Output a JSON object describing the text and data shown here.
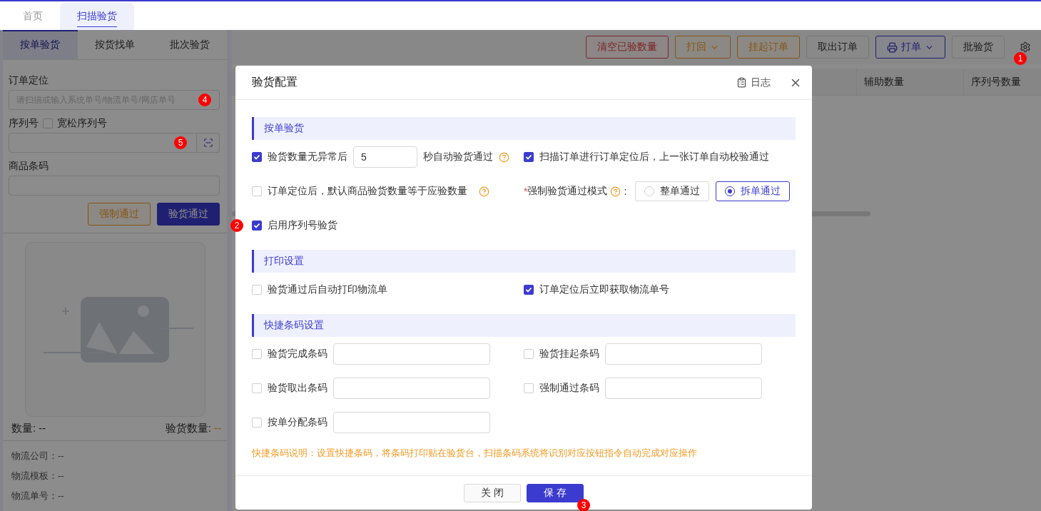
{
  "top_tabs": [
    {
      "label": "首页",
      "selected": false
    },
    {
      "label": "扫描验货",
      "selected": true
    }
  ],
  "left_panel": {
    "tabs": [
      {
        "label": "按单验货",
        "selected": true
      },
      {
        "label": "按货找单",
        "selected": false
      },
      {
        "label": "批次验货",
        "selected": false
      }
    ],
    "order_field": {
      "label": "订单定位",
      "placeholder": "请扫描或输入系统单号/物流单号/网店单号",
      "badge": "4"
    },
    "serial_field": {
      "label": "序列号",
      "loose_label": "宽松序列号",
      "loose_checked": false,
      "badge": "5"
    },
    "barcode_field": {
      "label": "商品条码"
    },
    "buttons": [
      {
        "label": "强制通过",
        "kind": "warning"
      },
      {
        "label": "验货通过",
        "kind": "primary"
      }
    ],
    "quantity": {
      "label": "数量:",
      "value": "--"
    },
    "checked_quantity": {
      "label": "验货数量:",
      "value": "--"
    },
    "info": [
      "物流公司：--",
      "物流模板：--",
      "物流单号：--"
    ]
  },
  "toolbar": {
    "buttons": [
      {
        "label": "清空已验数量",
        "kind": "danger",
        "dropdown": false
      },
      {
        "label": "打回",
        "kind": "warning",
        "dropdown": true
      },
      {
        "label": "挂起订单",
        "kind": "warning",
        "dropdown": false
      },
      {
        "label": "取出订单",
        "kind": "default",
        "dropdown": false
      },
      {
        "label": "打单",
        "kind": "primary",
        "dropdown": true
      },
      {
        "label": "批验货",
        "kind": "default",
        "dropdown": false
      }
    ],
    "settings_badge": "1"
  },
  "table": {
    "columns": [
      "辅助数量",
      "序列号数量"
    ]
  },
  "dialog": {
    "title": "验货配置",
    "log_label": "日志",
    "sections": [
      {
        "title": "按单验货",
        "items": [
          {
            "kind": "check-input",
            "label": "验货数量无异常后",
            "checked": true,
            "value": "5",
            "suffix": "秒自动验货通过",
            "help": true
          },
          {
            "kind": "check",
            "label": "扫描订单进行订单定位后，上一张订单自动校验通过",
            "checked": true,
            "help": false
          },
          {
            "kind": "check",
            "label": "订单定位后，默认商品验货数量等于应验数量",
            "checked": false,
            "help": true
          },
          {
            "kind": "radio",
            "required_mark": "*",
            "label": "强制验货通过模式",
            "help": true,
            "label_suffix": ":",
            "options": [
              {
                "label": "整单通过",
                "selected": false
              },
              {
                "label": "拆单通过",
                "selected": true
              }
            ]
          },
          {
            "kind": "check",
            "label": "启用序列号验货",
            "checked": true,
            "help": false,
            "badge": "2"
          }
        ]
      },
      {
        "title": "打印设置",
        "items": [
          {
            "kind": "check",
            "label": "验货通过后自动打印物流单",
            "checked": false,
            "help": false
          },
          {
            "kind": "check",
            "label": "订单定位后立即获取物流单号",
            "checked": true,
            "help": false
          }
        ]
      },
      {
        "title": "快捷条码设置",
        "items": [
          {
            "kind": "check-field",
            "label": "验货完成条码",
            "checked": false
          },
          {
            "kind": "check-field",
            "label": "验货挂起条码",
            "checked": false
          },
          {
            "kind": "check-field",
            "label": "验货取出条码",
            "checked": false
          },
          {
            "kind": "check-field",
            "label": "强制通过条码",
            "checked": false
          },
          {
            "kind": "check-field",
            "label": "按单分配条码",
            "checked": false
          }
        ]
      }
    ],
    "note": "快捷条码说明：设置快捷条码，将条码打印贴在验货台，扫描条码系统将识别对应按钮指令自动完成对应操作",
    "footer_buttons": [
      {
        "label": "关 闭",
        "kind": "default"
      },
      {
        "label": "保 存",
        "kind": "primary",
        "badge": "3"
      }
    ]
  }
}
